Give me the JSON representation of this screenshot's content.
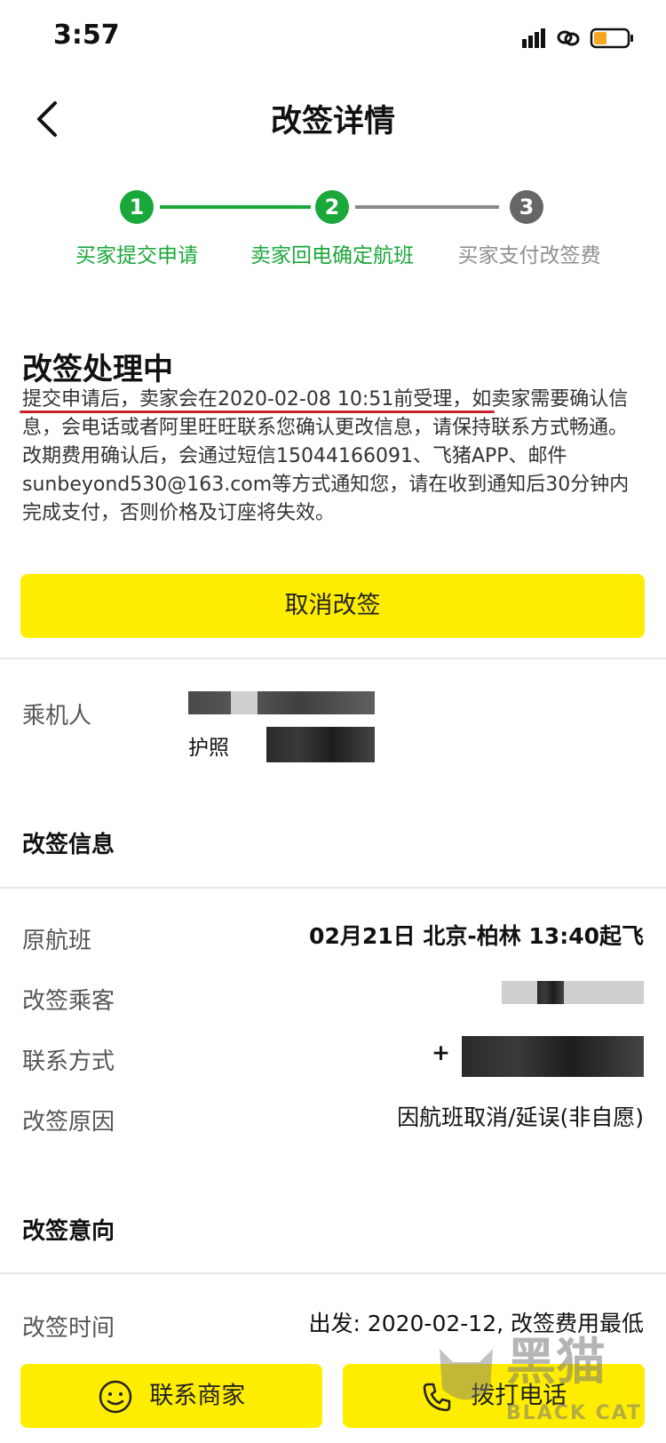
{
  "status_bar": {
    "time": "3:57"
  },
  "nav": {
    "title": "改签详情"
  },
  "steps": [
    {
      "number": "1",
      "label": "买家提交申请"
    },
    {
      "number": "2",
      "label": "卖家回电确定航班"
    },
    {
      "number": "3",
      "label": "买家支付改签费"
    }
  ],
  "processing": {
    "title": "改签处理中",
    "description": "提交申请后，卖家会在2020-02-08 10:51前受理，如卖家需要确认信息，会电话或者阿里旺旺联系您确认更改信息，请保持联系方式畅通。改期费用确认后，会通过短信15044166091、飞猪APP、邮件sunbeyond530@163.com等方式通知您，请在收到通知后30分钟内完成支付，否则价格及订座将失效。",
    "cancel_button": "取消改签"
  },
  "passenger": {
    "label": "乘机人",
    "passport_label": "护照"
  },
  "change_info": {
    "section_title": "改签信息",
    "rows": [
      {
        "label": "原航班",
        "value": "02月21日 北京-柏林 13:40起飞"
      },
      {
        "label": "改签乘客",
        "value": ""
      },
      {
        "label": "联系方式",
        "value": "+"
      },
      {
        "label": "改签原因",
        "value": "因航班取消/延误(非自愿)"
      }
    ]
  },
  "intention": {
    "section_title": "改签意向",
    "time_label": "改签时间",
    "time_value": "出发: 2020-02-12, 改签费用最低"
  },
  "bottom_bar": {
    "contact_seller": "联系商家",
    "call_phone": "拨打电话"
  },
  "watermark": {
    "text_cn": "黑猫",
    "text_en": "BLACK CAT"
  },
  "colors": {
    "accent_yellow": "#ffed00",
    "step_green": "#1aa83a",
    "step_grey": "#666666",
    "underline_red": "#c8232c"
  }
}
